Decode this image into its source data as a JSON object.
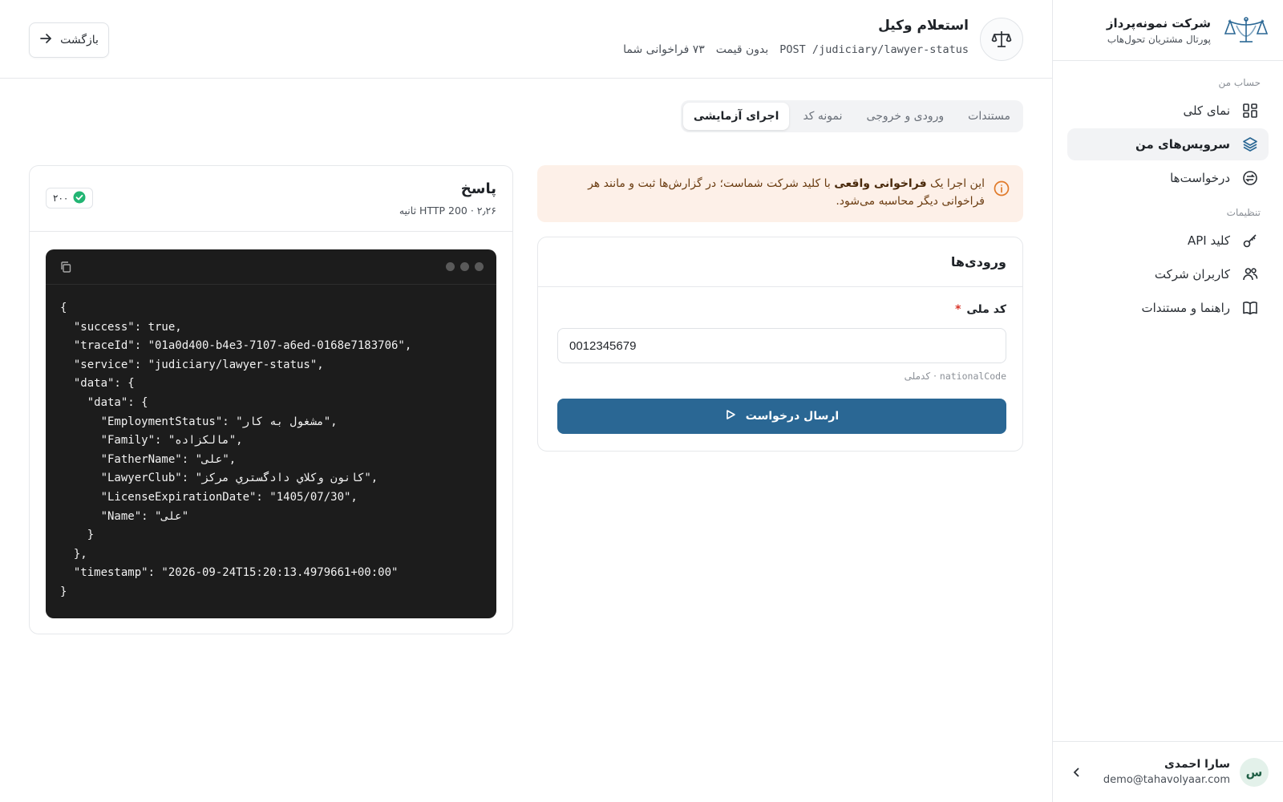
{
  "colors": {
    "accent": "#2a6794",
    "alert_bg": "#fdf0e8",
    "alert_icon": "#e07a2a",
    "success": "#22b573",
    "code_bg": "#1c1c1c"
  },
  "sidebar": {
    "brand_name": "شرکت نمونه‌پرداز",
    "brand_sub": "پورتال مشتریان تحول‌هاب",
    "section_account": "حساب من",
    "section_settings": "تنظیمات",
    "items": [
      {
        "label": "نمای کلی",
        "icon": "grid-icon"
      },
      {
        "label": "سرویس‌های من",
        "icon": "layers-icon",
        "active": true
      },
      {
        "label": "درخواست‌ها",
        "icon": "exchange-icon"
      },
      {
        "label": "کلید API",
        "icon": "key-icon"
      },
      {
        "label": "کاربران شرکت",
        "icon": "users-icon"
      },
      {
        "label": "راهنما و مستندات",
        "icon": "book-icon"
      }
    ],
    "user": {
      "initial": "س",
      "name": "سارا احمدی",
      "email": "demo@tahavolyaar.com"
    }
  },
  "header": {
    "title": "استعلام وکیل",
    "endpoint": "POST /judiciary/lawyer-status",
    "price": "بدون قیمت",
    "calls": "۷۳ فراخوانی شما",
    "back_label": "بازگشت"
  },
  "tabs": [
    "مستندات",
    "ورودی و خروجی",
    "نمونه کد",
    "اجرای آزمایشی"
  ],
  "active_tab": "اجرای آزمایشی",
  "alert": {
    "part1": "این اجرا یک ",
    "bold": "فراخوانی واقعی",
    "part2": " با کلید شرکت شماست؛ در گزارش‌ها ثبت و مانند هر فراخوانی دیگر محاسبه می‌شود."
  },
  "inputs": {
    "title": "ورودی‌ها",
    "field_label": "کد ملی",
    "required_mark": "*",
    "field_value": "0012345679",
    "hint_key": "nationalCode",
    "hint_sep": "·",
    "hint_desc": "کدملی",
    "send_label": "ارسال درخواست"
  },
  "response": {
    "title": "پاسخ",
    "meta": "HTTP 200 · ۲٫۲۶ ثانیه",
    "status_code": "۲۰۰",
    "code": "{\n  \"success\": true,\n  \"traceId\": \"01a0d400-b4e3-7107-a6ed-0168e7183706\",\n  \"service\": \"judiciary/lawyer-status\",\n  \"data\": {\n    \"data\": {\n      \"EmploymentStatus\": \"مشغول به کار\",\n      \"Family\": \"مالکزاده\",\n      \"FatherName\": \"علی\",\n      \"LawyerClub\": \"کانون وكلاي دادگستري مركز\",\n      \"LicenseExpirationDate\": \"1405/07/30\",\n      \"Name\": \"علی\"\n    }\n  },\n  \"timestamp\": \"2026-09-24T15:20:13.4979661+00:00\"\n}"
  }
}
